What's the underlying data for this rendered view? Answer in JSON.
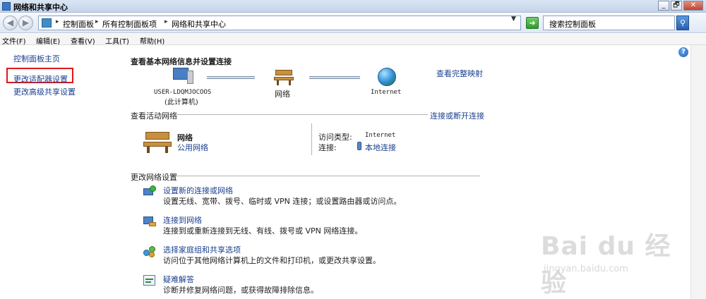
{
  "window": {
    "title": "网络和共享中心",
    "buttons": [
      "_",
      "🗗",
      "✕"
    ]
  },
  "address_bar": {
    "crumbs": [
      "控制面板",
      "所有控制面板项",
      "网络和共享中心"
    ],
    "search_placeholder": "搜索控制面板"
  },
  "menu": [
    "文件(F)",
    "编辑(E)",
    "查看(V)",
    "工具(T)",
    "帮助(H)"
  ],
  "sidebar": {
    "home": "控制面板主页",
    "links": [
      "更改适配器设置",
      "更改高级共享设置"
    ]
  },
  "main": {
    "heading": "查看基本网络信息并设置连接",
    "full_map_link": "查看完整映射",
    "map": {
      "computer_name": "USER-LDQMJOCOOS",
      "computer_sub": "(此计算机)",
      "network": "网络",
      "internet": "Internet"
    },
    "active_networks": {
      "label": "查看活动网络",
      "connect_link": "连接或断开连接",
      "network_name": "网络",
      "network_type": "公用网络",
      "access_type_label": "访问类型:",
      "access_type_value": "Internet",
      "connections_label": "连接:",
      "connections_value": "本地连接"
    },
    "change_settings": {
      "label": "更改网络设置",
      "tasks": [
        {
          "title": "设置新的连接或网络",
          "desc": "设置无线、宽带、拨号、临时或 VPN 连接；或设置路由器或访问点。",
          "icon": "new-connection-icon"
        },
        {
          "title": "连接到网络",
          "desc": "连接到或重新连接到无线、有线、拨号或 VPN 网络连接。",
          "icon": "connect-network-icon"
        },
        {
          "title": "选择家庭组和共享选项",
          "desc": "访问位于其他网络计算机上的文件和打印机，或更改共享设置。",
          "icon": "homegroup-icon"
        },
        {
          "title": "疑难解答",
          "desc": "诊断并修复网络问题，或获得故障排除信息。",
          "icon": "troubleshoot-icon"
        }
      ]
    }
  },
  "watermark": {
    "main": "Bai du 经验",
    "sub": "jingyan.baidu.com"
  },
  "colors": {
    "link": "#1a3f8f",
    "highlight": "#e0191b"
  }
}
